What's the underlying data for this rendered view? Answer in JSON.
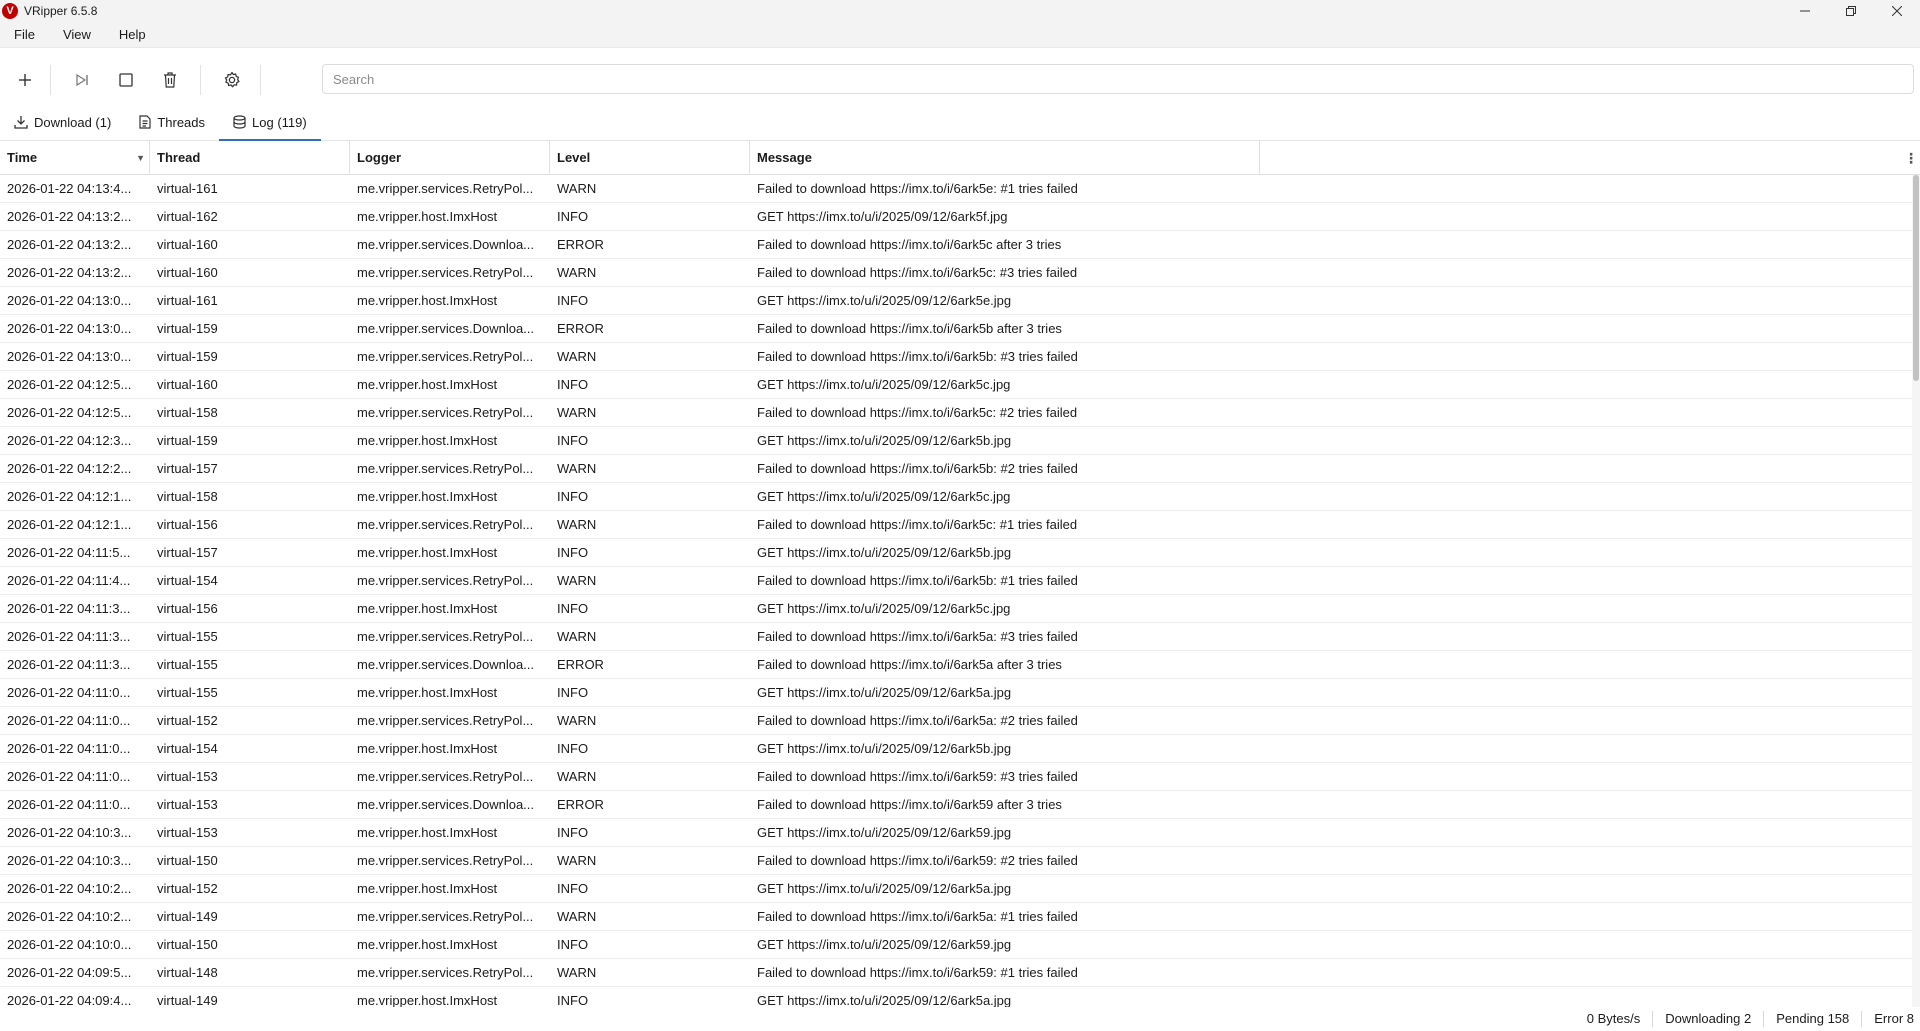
{
  "window": {
    "title": "VRipper 6.5.8",
    "logo_letter": "V"
  },
  "menu": [
    {
      "label": "File"
    },
    {
      "label": "View"
    },
    {
      "label": "Help"
    }
  ],
  "toolbar": {
    "icons": [
      "plus-icon",
      "skip-forward-icon",
      "stop-icon",
      "trash-icon",
      "gear-icon"
    ]
  },
  "search": {
    "placeholder": "Search",
    "value": ""
  },
  "tabs": [
    {
      "label": "Download (1)",
      "icon": "download-icon",
      "active": false
    },
    {
      "label": "Threads",
      "icon": "document-icon",
      "active": false
    },
    {
      "label": "Log (119)",
      "icon": "database-icon",
      "active": true
    }
  ],
  "table": {
    "columns": [
      "Time",
      "Thread",
      "Logger",
      "Level",
      "Message"
    ],
    "sorted_column": "Time",
    "rows": [
      {
        "time": "2026-01-22 04:13:4...",
        "thread": "virtual-161",
        "logger": "me.vripper.services.RetryPol...",
        "level": "WARN",
        "message": "Failed to download https://imx.to/i/6ark5e: #1 tries failed"
      },
      {
        "time": "2026-01-22 04:13:2...",
        "thread": "virtual-162",
        "logger": "me.vripper.host.ImxHost",
        "level": "INFO",
        "message": "GET https://imx.to/u/i/2025/09/12/6ark5f.jpg"
      },
      {
        "time": "2026-01-22 04:13:2...",
        "thread": "virtual-160",
        "logger": "me.vripper.services.Downloa...",
        "level": "ERROR",
        "message": "Failed to download https://imx.to/i/6ark5c after 3 tries"
      },
      {
        "time": "2026-01-22 04:13:2...",
        "thread": "virtual-160",
        "logger": "me.vripper.services.RetryPol...",
        "level": "WARN",
        "message": "Failed to download https://imx.to/i/6ark5c: #3 tries failed"
      },
      {
        "time": "2026-01-22 04:13:0...",
        "thread": "virtual-161",
        "logger": "me.vripper.host.ImxHost",
        "level": "INFO",
        "message": "GET https://imx.to/u/i/2025/09/12/6ark5e.jpg"
      },
      {
        "time": "2026-01-22 04:13:0...",
        "thread": "virtual-159",
        "logger": "me.vripper.services.Downloa...",
        "level": "ERROR",
        "message": "Failed to download https://imx.to/i/6ark5b after 3 tries"
      },
      {
        "time": "2026-01-22 04:13:0...",
        "thread": "virtual-159",
        "logger": "me.vripper.services.RetryPol...",
        "level": "WARN",
        "message": "Failed to download https://imx.to/i/6ark5b: #3 tries failed"
      },
      {
        "time": "2026-01-22 04:12:5...",
        "thread": "virtual-160",
        "logger": "me.vripper.host.ImxHost",
        "level": "INFO",
        "message": "GET https://imx.to/u/i/2025/09/12/6ark5c.jpg"
      },
      {
        "time": "2026-01-22 04:12:5...",
        "thread": "virtual-158",
        "logger": "me.vripper.services.RetryPol...",
        "level": "WARN",
        "message": "Failed to download https://imx.to/i/6ark5c: #2 tries failed"
      },
      {
        "time": "2026-01-22 04:12:3...",
        "thread": "virtual-159",
        "logger": "me.vripper.host.ImxHost",
        "level": "INFO",
        "message": "GET https://imx.to/u/i/2025/09/12/6ark5b.jpg"
      },
      {
        "time": "2026-01-22 04:12:2...",
        "thread": "virtual-157",
        "logger": "me.vripper.services.RetryPol...",
        "level": "WARN",
        "message": "Failed to download https://imx.to/i/6ark5b: #2 tries failed"
      },
      {
        "time": "2026-01-22 04:12:1...",
        "thread": "virtual-158",
        "logger": "me.vripper.host.ImxHost",
        "level": "INFO",
        "message": "GET https://imx.to/u/i/2025/09/12/6ark5c.jpg"
      },
      {
        "time": "2026-01-22 04:12:1...",
        "thread": "virtual-156",
        "logger": "me.vripper.services.RetryPol...",
        "level": "WARN",
        "message": "Failed to download https://imx.to/i/6ark5c: #1 tries failed"
      },
      {
        "time": "2026-01-22 04:11:5...",
        "thread": "virtual-157",
        "logger": "me.vripper.host.ImxHost",
        "level": "INFO",
        "message": "GET https://imx.to/u/i/2025/09/12/6ark5b.jpg"
      },
      {
        "time": "2026-01-22 04:11:4...",
        "thread": "virtual-154",
        "logger": "me.vripper.services.RetryPol...",
        "level": "WARN",
        "message": "Failed to download https://imx.to/i/6ark5b: #1 tries failed"
      },
      {
        "time": "2026-01-22 04:11:3...",
        "thread": "virtual-156",
        "logger": "me.vripper.host.ImxHost",
        "level": "INFO",
        "message": "GET https://imx.to/u/i/2025/09/12/6ark5c.jpg"
      },
      {
        "time": "2026-01-22 04:11:3...",
        "thread": "virtual-155",
        "logger": "me.vripper.services.RetryPol...",
        "level": "WARN",
        "message": "Failed to download https://imx.to/i/6ark5a: #3 tries failed"
      },
      {
        "time": "2026-01-22 04:11:3...",
        "thread": "virtual-155",
        "logger": "me.vripper.services.Downloa...",
        "level": "ERROR",
        "message": "Failed to download https://imx.to/i/6ark5a after 3 tries"
      },
      {
        "time": "2026-01-22 04:11:0...",
        "thread": "virtual-155",
        "logger": "me.vripper.host.ImxHost",
        "level": "INFO",
        "message": "GET https://imx.to/u/i/2025/09/12/6ark5a.jpg"
      },
      {
        "time": "2026-01-22 04:11:0...",
        "thread": "virtual-152",
        "logger": "me.vripper.services.RetryPol...",
        "level": "WARN",
        "message": "Failed to download https://imx.to/i/6ark5a: #2 tries failed"
      },
      {
        "time": "2026-01-22 04:11:0...",
        "thread": "virtual-154",
        "logger": "me.vripper.host.ImxHost",
        "level": "INFO",
        "message": "GET https://imx.to/u/i/2025/09/12/6ark5b.jpg"
      },
      {
        "time": "2026-01-22 04:11:0...",
        "thread": "virtual-153",
        "logger": "me.vripper.services.RetryPol...",
        "level": "WARN",
        "message": "Failed to download https://imx.to/i/6ark59: #3 tries failed"
      },
      {
        "time": "2026-01-22 04:11:0...",
        "thread": "virtual-153",
        "logger": "me.vripper.services.Downloa...",
        "level": "ERROR",
        "message": "Failed to download https://imx.to/i/6ark59 after 3 tries"
      },
      {
        "time": "2026-01-22 04:10:3...",
        "thread": "virtual-153",
        "logger": "me.vripper.host.ImxHost",
        "level": "INFO",
        "message": "GET https://imx.to/u/i/2025/09/12/6ark59.jpg"
      },
      {
        "time": "2026-01-22 04:10:3...",
        "thread": "virtual-150",
        "logger": "me.vripper.services.RetryPol...",
        "level": "WARN",
        "message": "Failed to download https://imx.to/i/6ark59: #2 tries failed"
      },
      {
        "time": "2026-01-22 04:10:2...",
        "thread": "virtual-152",
        "logger": "me.vripper.host.ImxHost",
        "level": "INFO",
        "message": "GET https://imx.to/u/i/2025/09/12/6ark5a.jpg"
      },
      {
        "time": "2026-01-22 04:10:2...",
        "thread": "virtual-149",
        "logger": "me.vripper.services.RetryPol...",
        "level": "WARN",
        "message": "Failed to download https://imx.to/i/6ark5a: #1 tries failed"
      },
      {
        "time": "2026-01-22 04:10:0...",
        "thread": "virtual-150",
        "logger": "me.vripper.host.ImxHost",
        "level": "INFO",
        "message": "GET https://imx.to/u/i/2025/09/12/6ark59.jpg"
      },
      {
        "time": "2026-01-22 04:09:5...",
        "thread": "virtual-148",
        "logger": "me.vripper.services.RetryPol...",
        "level": "WARN",
        "message": "Failed to download https://imx.to/i/6ark59: #1 tries failed"
      },
      {
        "time": "2026-01-22 04:09:4...",
        "thread": "virtual-149",
        "logger": "me.vripper.host.ImxHost",
        "level": "INFO",
        "message": "GET https://imx.to/u/i/2025/09/12/6ark5a.jpg"
      }
    ]
  },
  "status": {
    "speed": "0 Bytes/s",
    "downloading": "Downloading 2",
    "pending": "Pending 158",
    "error": "Error 8"
  }
}
